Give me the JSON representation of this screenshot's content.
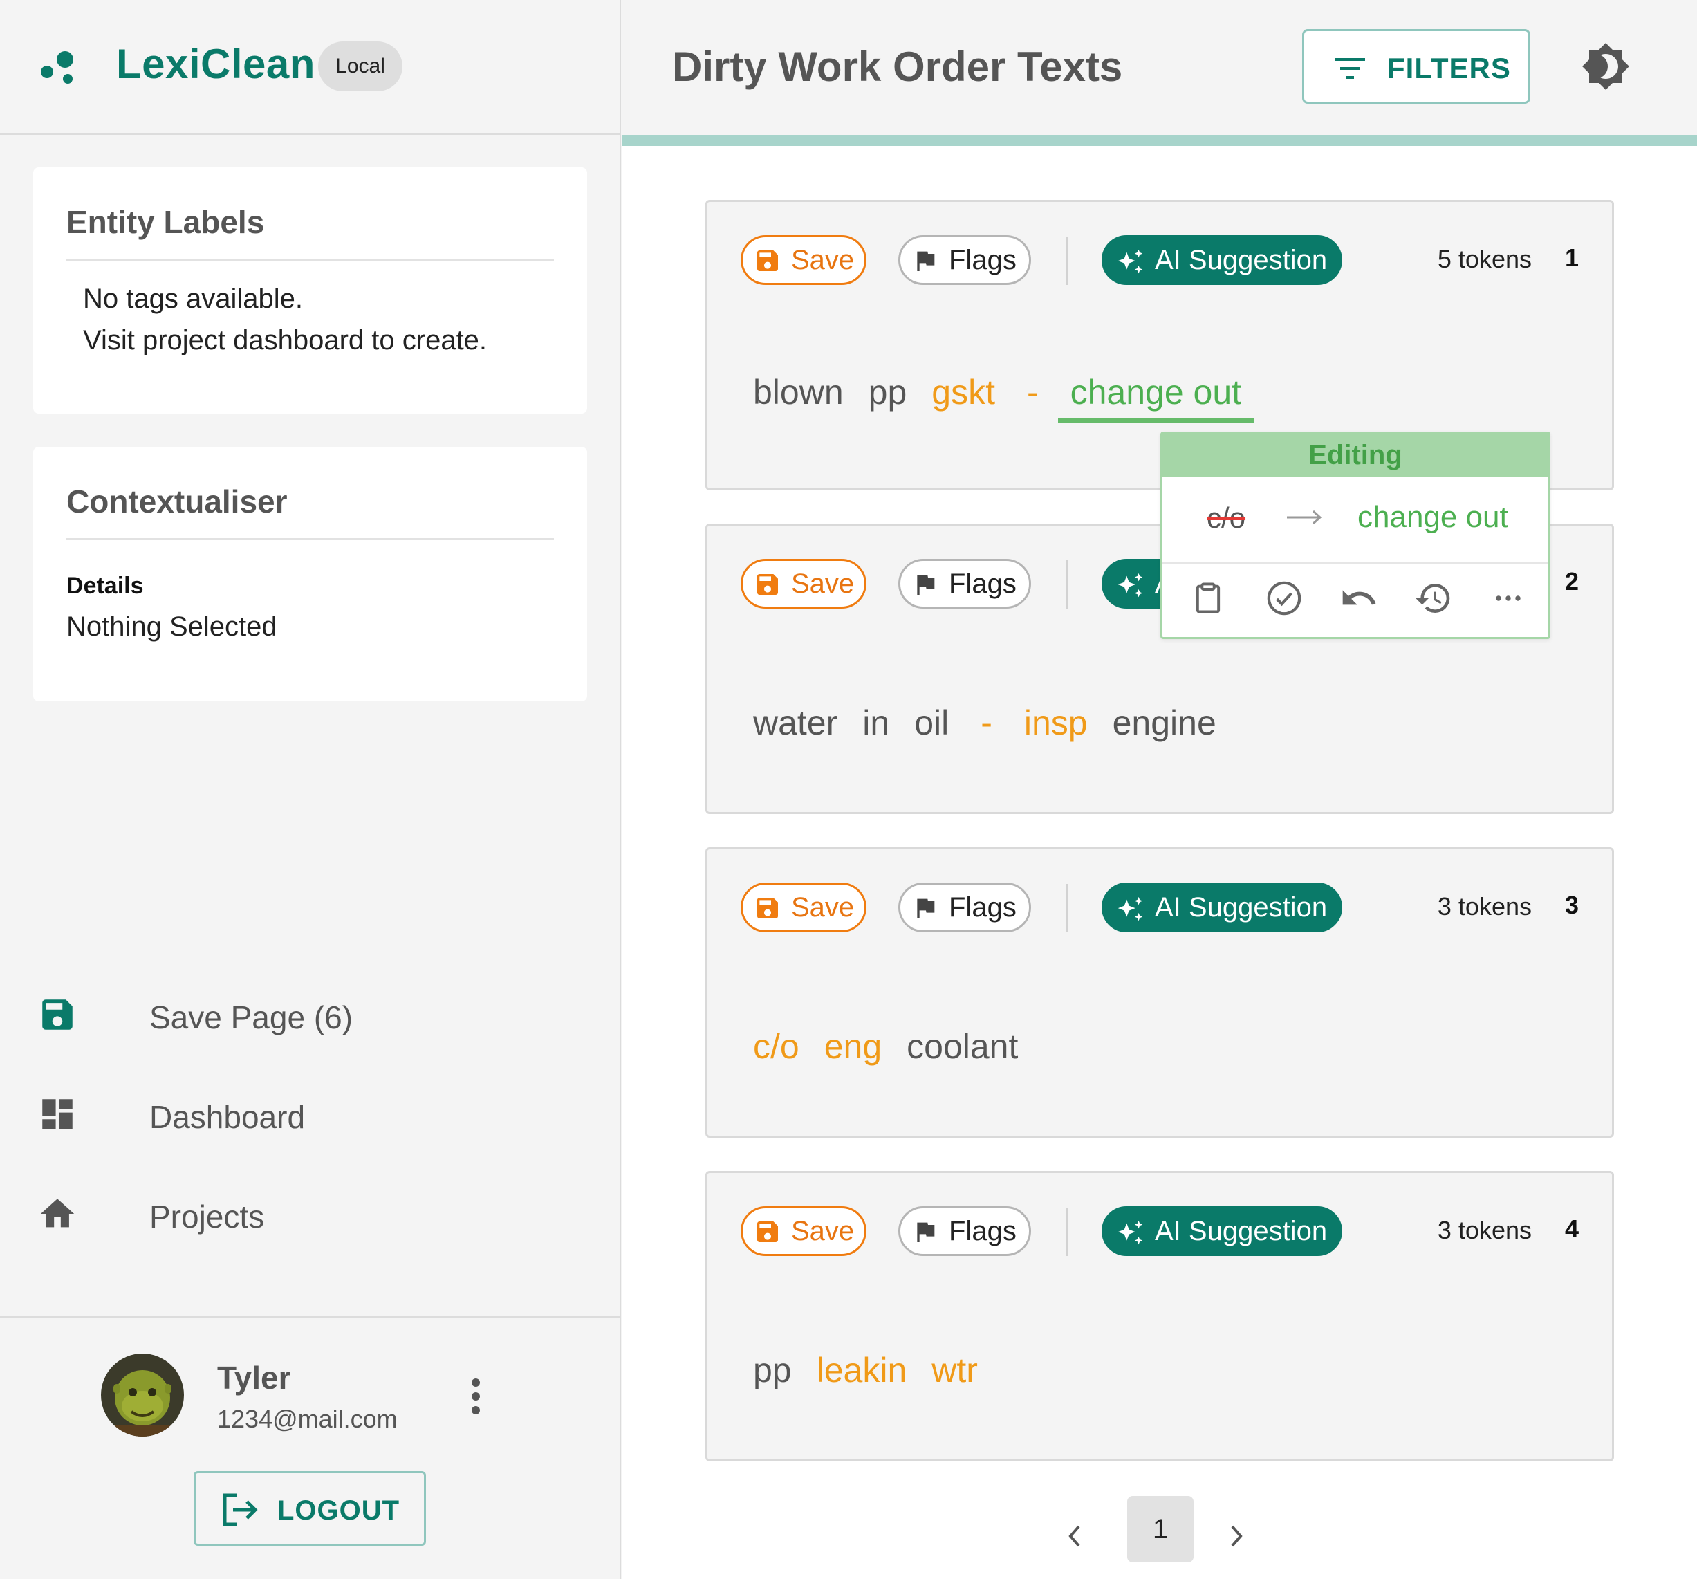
{
  "app": {
    "name": "LexiClean",
    "mode_badge": "Local",
    "brand_color": "#0a7a69"
  },
  "sidebar": {
    "entity_labels": {
      "title": "Entity Labels",
      "line1": "No tags available.",
      "line2": "Visit project dashboard to create."
    },
    "contextualiser": {
      "title": "Contextualiser",
      "details_label": "Details",
      "details_value": "Nothing Selected"
    },
    "nav": [
      {
        "label": "Save Page (6)",
        "icon": "save-icon"
      },
      {
        "label": "Dashboard",
        "icon": "dashboard-icon"
      },
      {
        "label": "Projects",
        "icon": "home-icon"
      }
    ],
    "user": {
      "name": "Tyler",
      "email": "1234@mail.com",
      "logout_label": "LOGOUT"
    }
  },
  "header": {
    "title": "Dirty Work Order Texts",
    "filters_label": "FILTERS",
    "theme_icon": "brightness-icon"
  },
  "card_labels": {
    "save": "Save",
    "flags": "Flags",
    "ai": "AI Suggestion"
  },
  "texts": [
    {
      "index": "1",
      "token_count": "5 tokens",
      "tokens": [
        {
          "text": "blown",
          "state": "normal"
        },
        {
          "text": "pp",
          "state": "normal"
        },
        {
          "text": "gskt",
          "state": "unknown"
        },
        {
          "text": "-",
          "state": "unknown"
        },
        {
          "text": "change out",
          "state": "replaced"
        }
      ]
    },
    {
      "index": "2",
      "token_count": "",
      "tokens": [
        {
          "text": "water",
          "state": "normal"
        },
        {
          "text": "in",
          "state": "normal"
        },
        {
          "text": "oil",
          "state": "normal"
        },
        {
          "text": "-",
          "state": "unknown"
        },
        {
          "text": "insp",
          "state": "unknown"
        },
        {
          "text": "engine",
          "state": "normal"
        }
      ]
    },
    {
      "index": "3",
      "token_count": "3 tokens",
      "tokens": [
        {
          "text": "c/o",
          "state": "unknown"
        },
        {
          "text": "eng",
          "state": "unknown"
        },
        {
          "text": "coolant",
          "state": "normal"
        }
      ]
    },
    {
      "index": "4",
      "token_count": "3 tokens",
      "tokens": [
        {
          "text": "pp",
          "state": "normal"
        },
        {
          "text": "leakin",
          "state": "unknown"
        },
        {
          "text": "wtr",
          "state": "unknown"
        }
      ]
    }
  ],
  "edit_popover": {
    "header": "Editing",
    "original": "c/o",
    "replacement": "change out",
    "actions": [
      "clipboard-icon",
      "check-circle-icon",
      "undo-icon",
      "history-icon",
      "more-horizontal-icon"
    ]
  },
  "pagination": {
    "current_page": "1"
  },
  "colors": {
    "unknown_token": "#f09a18",
    "replaced_token": "#4caf50",
    "save_accent": "#f07c10",
    "progress": "#a7d4cb"
  }
}
